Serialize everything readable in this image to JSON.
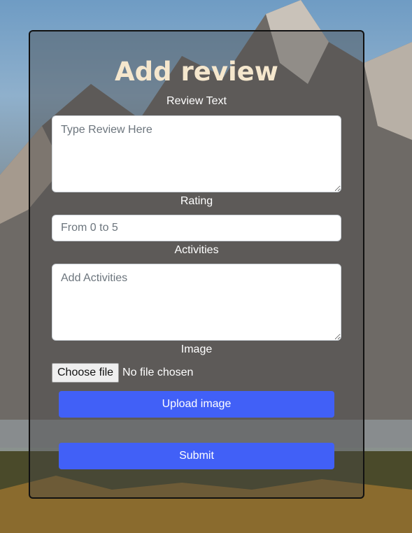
{
  "form": {
    "title": "Add review",
    "review_text_label": "Review Text",
    "review_text_placeholder": "Type Review Here",
    "rating_label": "Rating",
    "rating_placeholder": "From 0 to 5",
    "activities_label": "Activities",
    "activities_placeholder": "Add Activities",
    "image_label": "Image",
    "choose_file_label": "Choose file",
    "file_status": "No file chosen",
    "upload_label": "Upload image",
    "submit_label": "Submit"
  },
  "colors": {
    "title": "#f5e7cd",
    "button": "#4160f7",
    "card_border": "#111111"
  }
}
